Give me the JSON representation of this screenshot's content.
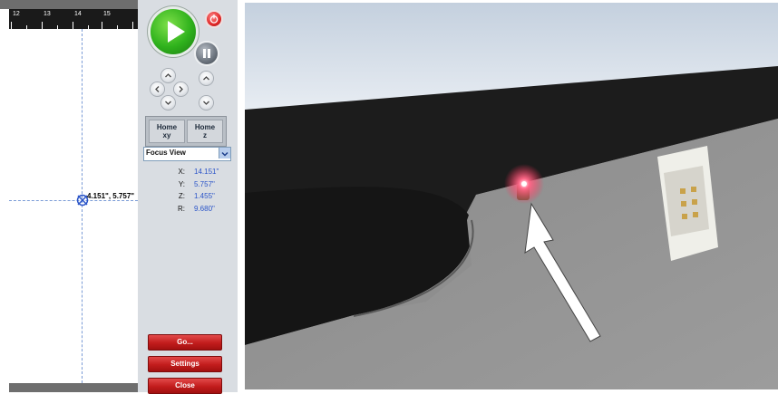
{
  "canvas": {
    "ruler_ticks": [
      "12",
      "13",
      "14",
      "15"
    ],
    "cursor_position": "4.151\", 5.757\""
  },
  "controls": {
    "home_xy": {
      "line1": "Home",
      "line2": "xy"
    },
    "home_z": {
      "line1": "Home",
      "line2": "z"
    },
    "view_select": {
      "selected": "Focus View"
    },
    "readout": [
      {
        "axis": "X:",
        "value": "14.151\""
      },
      {
        "axis": "Y:",
        "value": "5.757\""
      },
      {
        "axis": "Z:",
        "value": "1.455\""
      },
      {
        "axis": "R:",
        "value": "9.680\""
      }
    ],
    "buttons": {
      "go": "Go...",
      "settings": "Settings",
      "close": "Close"
    }
  },
  "colors": {
    "accent_blue": "#2a54c8",
    "play_green": "#2fb21c",
    "button_red": "#c21c1c",
    "panel_bg": "#d9dde2"
  },
  "icons": [
    "play-icon",
    "stop-icon",
    "pause-icon",
    "arrow-up-icon",
    "arrow-down-icon",
    "arrow-left-icon",
    "arrow-right-icon",
    "crosshair-icon",
    "chevron-down-icon"
  ]
}
